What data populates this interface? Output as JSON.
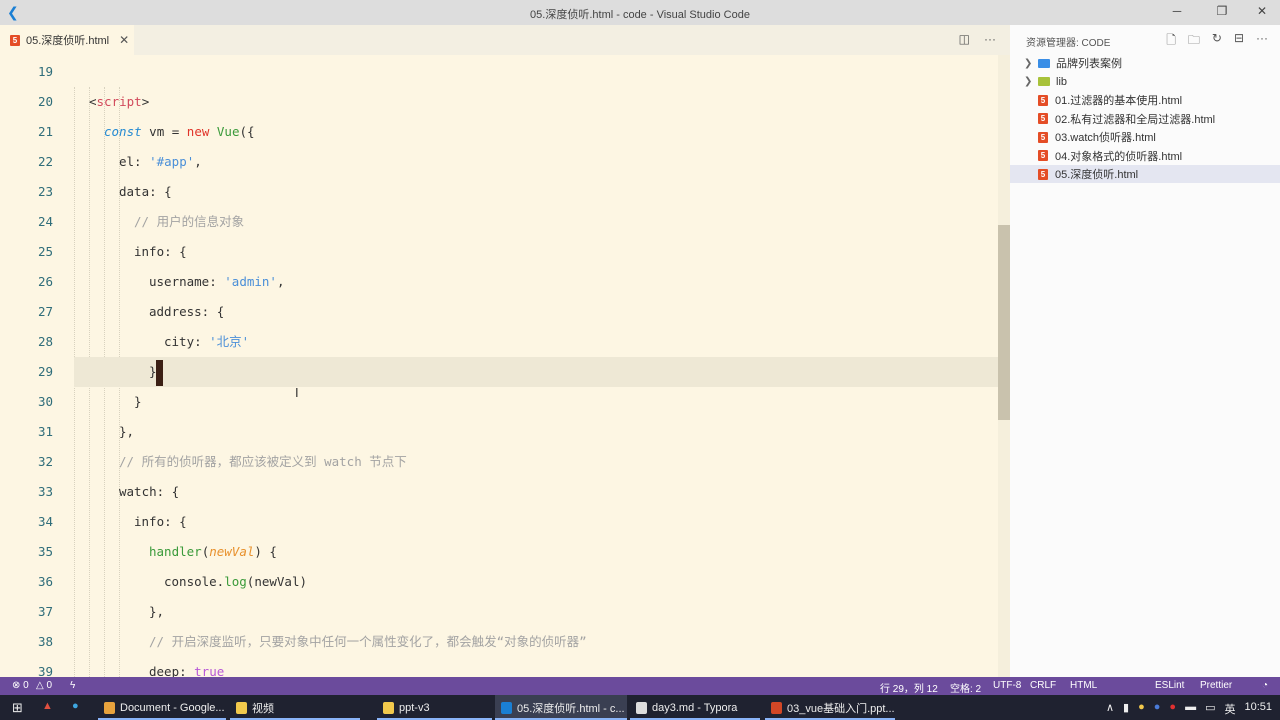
{
  "window": {
    "title": "05.深度侦听.html - code - Visual Studio Code",
    "logo": "vscode-icon",
    "minimize": "─",
    "maximize": "❐",
    "close": "✕"
  },
  "tabs": [
    {
      "label": "05.深度侦听.html",
      "icon": "html5-icon",
      "close": "✕"
    }
  ],
  "tab_actions": {
    "split": "◫",
    "more": "···"
  },
  "editor": {
    "current_line": 29,
    "lines": [
      {
        "n": "19",
        "indent": 0,
        "tokens": []
      },
      {
        "n": "20",
        "indent": 0,
        "tokens": [
          [
            "plain",
            "<"
          ],
          [
            "tag",
            "script"
          ],
          [
            "plain",
            ">"
          ]
        ]
      },
      {
        "n": "21",
        "indent": 1,
        "tokens": [
          [
            "kw",
            "const"
          ],
          [
            "plain",
            " vm = "
          ],
          [
            "new",
            "new"
          ],
          [
            "plain",
            " "
          ],
          [
            "fn",
            "Vue"
          ],
          [
            "plain",
            "({"
          ]
        ]
      },
      {
        "n": "22",
        "indent": 2,
        "tokens": [
          [
            "plain",
            "el: "
          ],
          [
            "str",
            "'#app'"
          ],
          [
            "plain",
            ","
          ]
        ]
      },
      {
        "n": "23",
        "indent": 2,
        "tokens": [
          [
            "plain",
            "data: {"
          ]
        ]
      },
      {
        "n": "24",
        "indent": 3,
        "tokens": [
          [
            "cmt",
            "// 用户的信息对象"
          ]
        ]
      },
      {
        "n": "25",
        "indent": 3,
        "tokens": [
          [
            "plain",
            "info: {"
          ]
        ]
      },
      {
        "n": "26",
        "indent": 4,
        "tokens": [
          [
            "plain",
            "username: "
          ],
          [
            "str",
            "'admin'"
          ],
          [
            "plain",
            ","
          ]
        ]
      },
      {
        "n": "27",
        "indent": 4,
        "tokens": [
          [
            "plain",
            "address: {"
          ]
        ]
      },
      {
        "n": "28",
        "indent": 5,
        "tokens": [
          [
            "plain",
            "city: "
          ],
          [
            "str",
            "'北京'"
          ]
        ]
      },
      {
        "n": "29",
        "indent": 4,
        "tokens": [
          [
            "plain",
            "}"
          ]
        ]
      },
      {
        "n": "30",
        "indent": 3,
        "tokens": [
          [
            "plain",
            "}"
          ]
        ]
      },
      {
        "n": "31",
        "indent": 2,
        "tokens": [
          [
            "plain",
            "},"
          ]
        ]
      },
      {
        "n": "32",
        "indent": 2,
        "tokens": [
          [
            "cmt",
            "// 所有的侦听器，都应该被定义到 watch 节点下"
          ]
        ]
      },
      {
        "n": "33",
        "indent": 2,
        "tokens": [
          [
            "plain",
            "watch: {"
          ]
        ]
      },
      {
        "n": "34",
        "indent": 3,
        "tokens": [
          [
            "plain",
            "info: {"
          ]
        ]
      },
      {
        "n": "35",
        "indent": 4,
        "tokens": [
          [
            "fn",
            "handler"
          ],
          [
            "plain",
            "("
          ],
          [
            "param",
            "newVal"
          ],
          [
            "plain",
            ") {"
          ]
        ]
      },
      {
        "n": "36",
        "indent": 5,
        "tokens": [
          [
            "plain",
            "console."
          ],
          [
            "fn",
            "log"
          ],
          [
            "plain",
            "(newVal)"
          ]
        ]
      },
      {
        "n": "37",
        "indent": 4,
        "tokens": [
          [
            "plain",
            "},"
          ]
        ]
      },
      {
        "n": "38",
        "indent": 4,
        "tokens": [
          [
            "cmt",
            "// 开启深度监听，只要对象中任何一个属性变化了，都会触发“对象的侦听器”"
          ]
        ]
      },
      {
        "n": "39",
        "indent": 4,
        "tokens": [
          [
            "plain",
            "deep: "
          ],
          [
            "bool",
            "true"
          ]
        ]
      }
    ]
  },
  "explorer": {
    "header": "资源管理器: CODE",
    "actions": [
      "new-file-icon",
      "new-folder-icon",
      "refresh-icon",
      "collapse-icon",
      "more-icon"
    ],
    "items": [
      {
        "label": "品牌列表案例",
        "type": "folder",
        "color": "#3a8ee6"
      },
      {
        "label": "lib",
        "type": "folder",
        "color": "#a8c23a"
      },
      {
        "label": "01.过滤器的基本使用.html",
        "type": "file"
      },
      {
        "label": "02.私有过滤器和全局过滤器.html",
        "type": "file"
      },
      {
        "label": "03.watch侦听器.html",
        "type": "file"
      },
      {
        "label": "04.对象格式的侦听器.html",
        "type": "file"
      },
      {
        "label": "05.深度侦听.html",
        "type": "file",
        "selected": true
      }
    ]
  },
  "statusbar": {
    "errors": "⊗ 0",
    "warnings": "△ 0",
    "position": "行 29，列 12",
    "spaces": "空格: 2",
    "encoding": "UTF-8",
    "eol": "CRLF",
    "language": "HTML",
    "extra": "ESLint",
    "prettier": "Prettier",
    "bell": "🔔"
  },
  "taskbar": {
    "items": [
      {
        "label": "Document - Google...",
        "color": "#e8a33d"
      },
      {
        "label": "视频",
        "color": "#f2c94c"
      },
      {
        "label": "ppt-v3",
        "color": "#f2c94c"
      },
      {
        "label": "05.深度侦听.html - c...",
        "color": "#1a7fd4",
        "active": true
      },
      {
        "label": "day3.md - Typora",
        "color": "#ddd"
      },
      {
        "label": "03_vue基础入门.ppt...",
        "color": "#d24726"
      }
    ],
    "ime": "英",
    "time": "10:51"
  },
  "colors": {
    "editor_bg": "#fdf6e3",
    "statusbar": "#6b4b9c",
    "accent": "#1a7fd4"
  }
}
